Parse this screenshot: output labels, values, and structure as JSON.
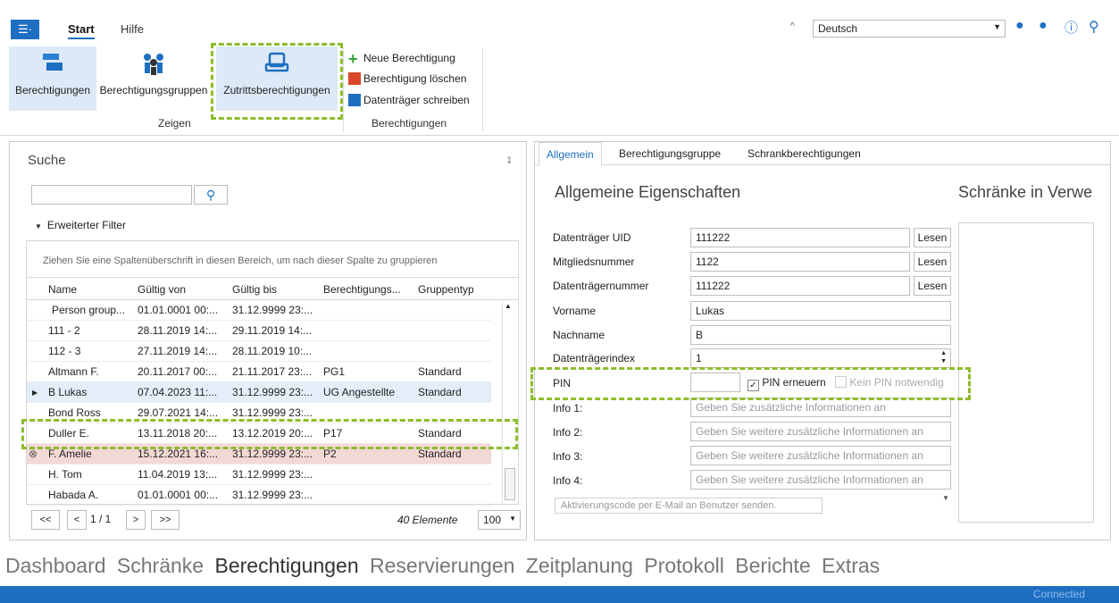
{
  "ribbon": {
    "tabs": [
      "Start",
      "Hilfe"
    ],
    "buttons_zeigen": [
      "Berechtigungen",
      "Berechtigungsgruppen",
      "Zutrittsberechtigungen"
    ],
    "group_zeigen": "Zeigen",
    "small_buttons": [
      "Neue Berechtigung",
      "Berechtigung löschen",
      "Datenträger schreiben"
    ],
    "group_berechtigungen": "Berechtigungen",
    "language": "Deutsch"
  },
  "left": {
    "title": "Suche",
    "filter_label": "Erweiterter Filter",
    "group_hint": "Ziehen Sie eine Spaltenüberschrift in diesen Bereich, um nach dieser Spalte zu gruppieren",
    "columns": [
      "Name",
      "Gültig von",
      "Gültig bis",
      "Berechtigungs...",
      "Gruppentyp"
    ],
    "rows": [
      [
        "Person group...",
        "01.01.0001 00:...",
        "31.12.9999 23:...",
        "",
        ""
      ],
      [
        "111 - 2",
        "28.11.2019 14:...",
        "29.11.2019 14:...",
        "",
        ""
      ],
      [
        "112 - 3",
        "27.11.2019 14:...",
        "28.11.2019 10:...",
        "",
        ""
      ],
      [
        "Altmann F.",
        "20.11.2017 00:...",
        "21.11.2017 23:...",
        "PG1",
        "Standard"
      ],
      [
        "B Lukas",
        "07.04.2023 11:...",
        "31.12.9999 23:...",
        "UG Angestellte",
        "Standard"
      ],
      [
        "Bond Ross",
        "29.07.2021 14:...",
        "31.12.9999 23:...",
        "",
        ""
      ],
      [
        "Duller E.",
        "13.11.2018 20:...",
        "13.12.2019 20:...",
        "P17",
        "Standard"
      ],
      [
        "F. Amelie",
        "15.12.2021 16:...",
        "31.12.9999 23:...",
        "P2",
        "Standard"
      ],
      [
        "H. Tom",
        "11.04.2019 13:...",
        "31.12.9999 23:...",
        "",
        ""
      ],
      [
        "Habada A.",
        "01.01.0001 00:...",
        "31.12.9999 23:...",
        "",
        ""
      ]
    ],
    "pager": {
      "first": "<<",
      "prev": "<",
      "page": "1 / 1",
      "next": ">",
      "last": ">>",
      "count": "40 Elemente",
      "size": "100"
    }
  },
  "right": {
    "tabs": [
      "Allgemein",
      "Berechtigungsgruppe",
      "Schrankberechtigungen"
    ],
    "heading": "Allgemeine Eigenschaften",
    "side_heading": "Schränke in Verwe",
    "labels": [
      "Datenträger UID",
      "Mitgliedsnummer",
      "Datenträgernummer",
      "Vorname",
      "Nachname",
      "Datenträgerindex",
      "PIN",
      "Info 1:",
      "Info 2:",
      "Info 3:",
      "Info 4:"
    ],
    "values": {
      "uid": "111222",
      "mitglied": "1122",
      "dtnr": "111222",
      "vorname": "Lukas",
      "nachname": "B",
      "index": "1"
    },
    "lesen": "Lesen",
    "pin_erneuern": "PIN erneuern",
    "kein_pin": "Kein PIN notwendig",
    "info_placeholders": [
      "Geben Sie zusätzliche Informationen an",
      "Geben Sie weitere zusätzliche Informationen an",
      "Geben Sie weitere zusätzliche Informationen an",
      "Geben Sie weitere zusätzliche Informationen an"
    ],
    "aktivierung": "Aktivierungscode per E-Mail an Benutzer senden."
  },
  "nav": [
    "Dashboard",
    "Schränke",
    "Berechtigungen",
    "Reservierungen",
    "Zeitplanung",
    "Protokoll",
    "Berichte",
    "Extras"
  ],
  "status": "Connected"
}
